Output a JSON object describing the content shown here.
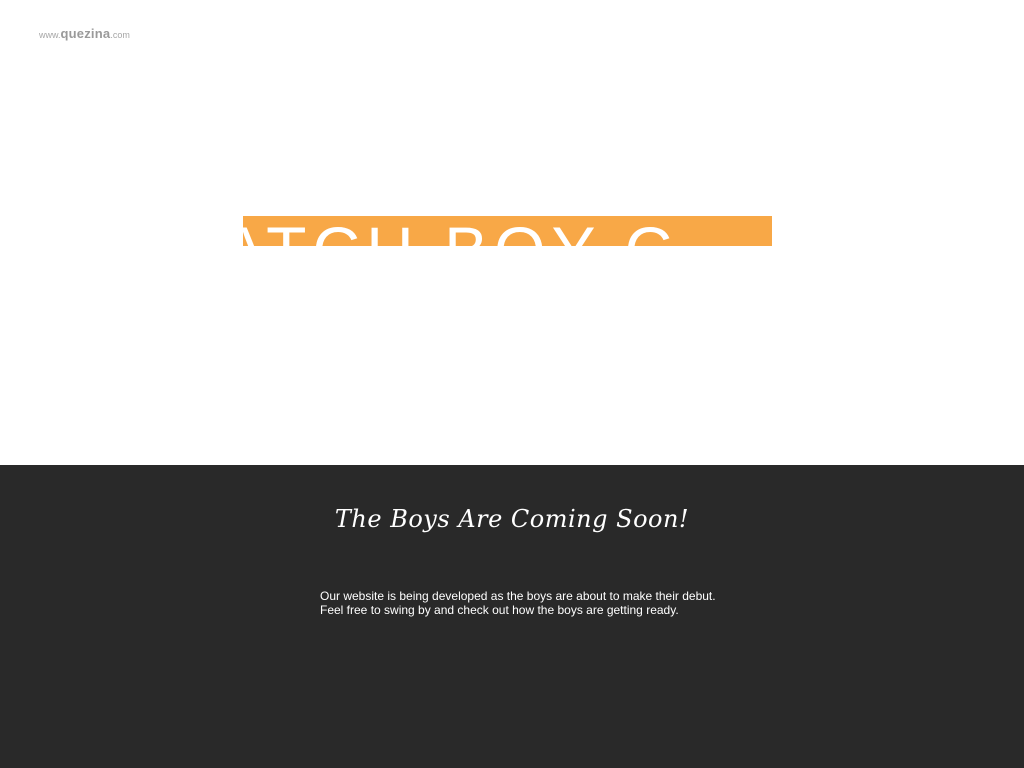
{
  "logo": {
    "prefix": "www.",
    "name": "quezina",
    "suffix": ".com"
  },
  "banner": {
    "text": "ATCH BOY C",
    "color": "#f8a847"
  },
  "main": {
    "headline": "The Boys Are Coming Soon!",
    "paragraph": [
      "Our website is being developed as the boys are about to make their debut.",
      "Feel free to swing by and check out how the boys are getting ready."
    ]
  },
  "colors": {
    "background_top": "#ffffff",
    "background_bottom": "#292929",
    "accent": "#f8a847"
  }
}
